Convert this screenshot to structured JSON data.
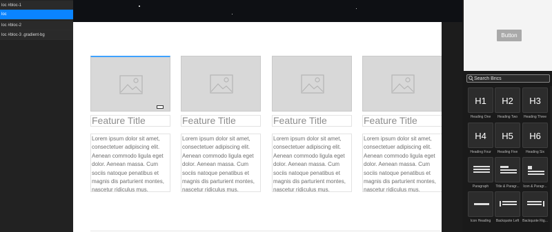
{
  "layers": {
    "items": [
      {
        "label": "loc #bloc-1"
      },
      {
        "label": "loc"
      },
      {
        "label": "loc #bloc-2"
      },
      {
        "label": "loc #bloc-3 .gradient-bg"
      }
    ]
  },
  "canvas": {
    "cards": [
      {
        "title": "Feature Title",
        "body": "Lorem ipsum dolor sit amet, consectetuer adipiscing elit. Aenean commodo ligula eget dolor. Aenean massa. Cum sociis natoque penatibus et magnis dis parturient montes, nascetur ridiculus mus."
      },
      {
        "title": "Feature Title",
        "body": "Lorem ipsum dolor sit amet, consectetuer adipiscing elit. Aenean commodo ligula eget dolor. Aenean massa. Cum sociis natoque penatibus et magnis dis parturient montes, nascetur ridiculus mus."
      },
      {
        "title": "Feature Title",
        "body": "Lorem ipsum dolor sit amet, consectetuer adipiscing elit. Aenean commodo ligula eget dolor. Aenean massa. Cum sociis natoque penatibus et magnis dis parturient montes, nascetur ridiculus mus."
      },
      {
        "title": "Feature Title",
        "body": "Lorem ipsum dolor sit amet, consectetuer adipiscing elit. Aenean commodo ligula eget dolor. Aenean massa. Cum sociis natoque penatibus et magnis dis parturient montes, nascetur ridiculus mus."
      }
    ]
  },
  "preview": {
    "button_label": "Button"
  },
  "brics": {
    "search_placeholder": "Search Brics",
    "items": [
      {
        "glyph": "H1",
        "label": "Heading One"
      },
      {
        "glyph": "H2",
        "label": "Heading Two"
      },
      {
        "glyph": "H3",
        "label": "Heading Three"
      },
      {
        "glyph": "H4",
        "label": "Heading Four"
      },
      {
        "glyph": "H5",
        "label": "Heading Five"
      },
      {
        "glyph": "H6",
        "label": "Heading Six"
      },
      {
        "glyph": "",
        "label": "Paragraph"
      },
      {
        "glyph": "",
        "label": "Title & Paragr..."
      },
      {
        "glyph": "",
        "label": "Icon & Paragr..."
      },
      {
        "glyph": "",
        "label": "Icon Heading"
      },
      {
        "glyph": "",
        "label": "Backquote Left"
      },
      {
        "glyph": "",
        "label": "Backquote Rig..."
      }
    ]
  },
  "colors": {
    "selection": "#0a84ff",
    "canvas_bg": "#ffffff",
    "panel_bg": "#222222"
  }
}
